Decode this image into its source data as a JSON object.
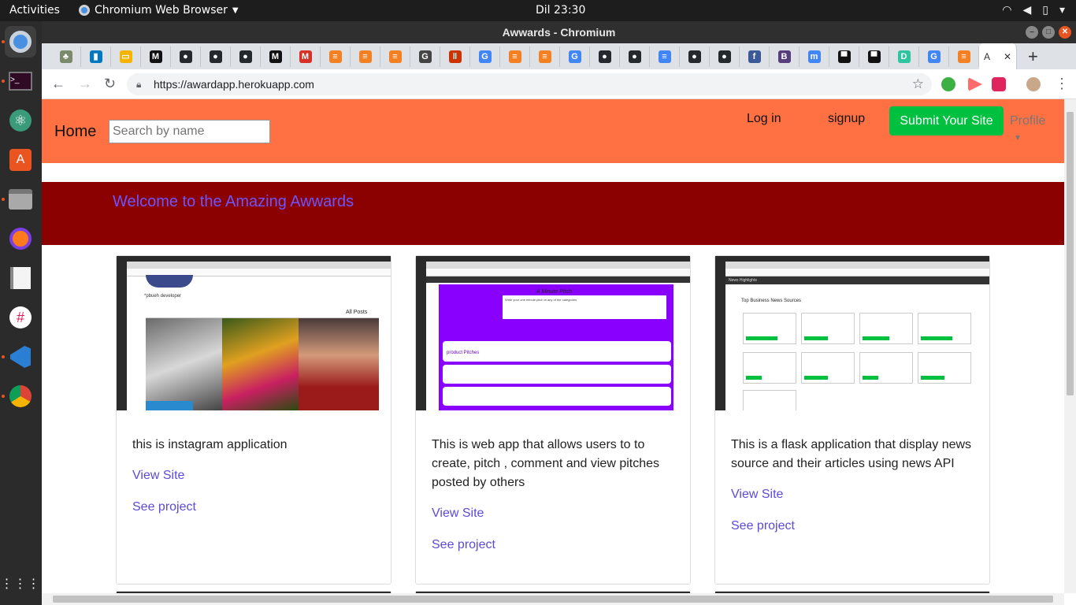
{
  "desktop": {
    "activities": "Activities",
    "app_name": "Chromium Web Browser",
    "clock": "Dil 23:30",
    "tray_icons": [
      "wifi-icon",
      "volume-icon",
      "battery-icon",
      "power-menu-icon"
    ]
  },
  "dock": {
    "items": [
      "chromium-icon",
      "terminal-icon",
      "atom-icon",
      "software-center-icon",
      "files-icon",
      "firefox-icon",
      "text-editor-icon",
      "slack-icon",
      "vscode-icon",
      "chrome-icon",
      "show-apps-icon"
    ]
  },
  "window": {
    "title": "Awwards - Chromium"
  },
  "tabs": [
    {
      "icon": "tree-favicon",
      "color": "#7a8a6a",
      "glyph": "♣"
    },
    {
      "icon": "trello-favicon",
      "color": "#0079bf",
      "glyph": "▮"
    },
    {
      "icon": "slides-favicon",
      "color": "#f4b400",
      "glyph": "▭"
    },
    {
      "icon": "medium-favicon",
      "color": "#111111",
      "glyph": "M"
    },
    {
      "icon": "github-favicon",
      "color": "#24292e",
      "glyph": "●"
    },
    {
      "icon": "github-favicon",
      "color": "#24292e",
      "glyph": "●"
    },
    {
      "icon": "github-favicon",
      "color": "#24292e",
      "glyph": "●"
    },
    {
      "icon": "medium-favicon",
      "color": "#111111",
      "glyph": "M"
    },
    {
      "icon": "gmail-favicon",
      "color": "#d93025",
      "glyph": "M"
    },
    {
      "icon": "stackoverflow-favicon",
      "color": "#f48024",
      "glyph": "≡"
    },
    {
      "icon": "stackoverflow-favicon",
      "color": "#f48024",
      "glyph": "≡"
    },
    {
      "icon": "stackoverflow-favicon",
      "color": "#f48024",
      "glyph": "≡"
    },
    {
      "icon": "docs-favicon",
      "color": "#444444",
      "glyph": "G"
    },
    {
      "icon": "pdf-favicon",
      "color": "#cc3300",
      "glyph": "‖"
    },
    {
      "icon": "google-favicon",
      "color": "#4285f4",
      "glyph": "G"
    },
    {
      "icon": "stackoverflow-favicon",
      "color": "#f48024",
      "glyph": "≡"
    },
    {
      "icon": "stackoverflow-favicon",
      "color": "#f48024",
      "glyph": "≡"
    },
    {
      "icon": "google-favicon",
      "color": "#4285f4",
      "glyph": "G"
    },
    {
      "icon": "github-favicon",
      "color": "#24292e",
      "glyph": "●"
    },
    {
      "icon": "github-favicon",
      "color": "#24292e",
      "glyph": "●"
    },
    {
      "icon": "google-docs-favicon",
      "color": "#4285f4",
      "glyph": "≡"
    },
    {
      "icon": "github-favicon",
      "color": "#24292e",
      "glyph": "●"
    },
    {
      "icon": "github-favicon",
      "color": "#24292e",
      "glyph": "●"
    },
    {
      "icon": "facebook-favicon",
      "color": "#3b5998",
      "glyph": "f"
    },
    {
      "icon": "bootstrap-favicon",
      "color": "#563d7c",
      "glyph": "B"
    },
    {
      "icon": "mdb-favicon",
      "color": "#4285f4",
      "glyph": "m"
    },
    {
      "icon": "heroku-favicon",
      "color": "#111111",
      "glyph": "▀"
    },
    {
      "icon": "heroku-favicon",
      "color": "#111111",
      "glyph": "▀"
    },
    {
      "icon": "dj-favicon",
      "color": "#2ec4a0",
      "glyph": "D"
    },
    {
      "icon": "google-favicon",
      "color": "#4285f4",
      "glyph": "G"
    },
    {
      "icon": "stackoverflow-favicon",
      "color": "#f48024",
      "glyph": "≡"
    }
  ],
  "active_tab": {
    "label": "A",
    "close": "✕"
  },
  "new_tab": "+",
  "omnibox": {
    "url": "https://awardapp.herokuapp.com"
  },
  "extensions": [
    {
      "icon": "green-extension-icon",
      "color": "#3cb043"
    },
    {
      "icon": "arrow-extension-icon",
      "color": "#ff6b6b"
    },
    {
      "icon": "pdf-extension-icon",
      "color": "#e0245e"
    },
    {
      "icon": "avatar-icon",
      "color": "#c9a88a"
    }
  ],
  "app": {
    "brand": "Home",
    "search_placeholder": "Search by name",
    "login": "Log in",
    "signup": "signup",
    "submit": "Submit Your Site",
    "profile": "Profile",
    "welcome": "Welcome to the Amazing Awwards",
    "colors": {
      "navbar": "#ff7042",
      "banner": "#8b0000",
      "submit": "#00c040",
      "link": "#5b4bd8"
    }
  },
  "cards": [
    {
      "description": "this is instagram application",
      "view_site": "View Site",
      "see_project": "See project",
      "preview": {
        "header": "All Posts",
        "sub": "*pbueh developer"
      }
    },
    {
      "description": "This is web app that allows users to to create, pitch , comment and view pitches posted by others",
      "view_site": "View Site",
      "see_project": "See project",
      "preview": {
        "header": "A Minute Pitch",
        "sub": "Write your one minute pitch in any of the categories",
        "label": "product Pitches"
      }
    },
    {
      "description": "This is a flask application that display news source and their articles using news API",
      "view_site": "View Site",
      "see_project": "See project",
      "preview": {
        "header": "Top Business News Sources",
        "sub": "News Highlights"
      }
    }
  ]
}
